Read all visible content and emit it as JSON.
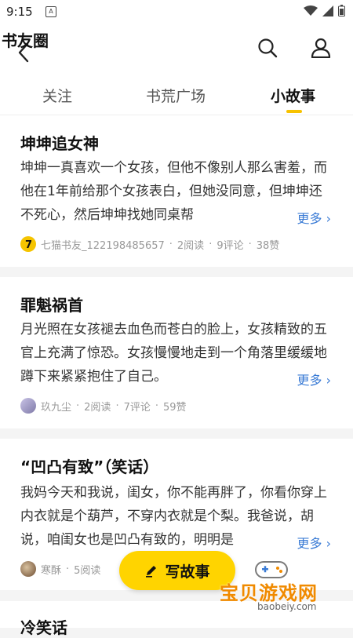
{
  "status_bar": {
    "time": "9:15",
    "notif_glyph": "A"
  },
  "app_bar": {
    "title": "书友圈"
  },
  "tabs": [
    {
      "label": "关注"
    },
    {
      "label": "书荒广场"
    },
    {
      "label": "小故事",
      "active": true
    }
  ],
  "stories": [
    {
      "title": "坤坤追女神",
      "body": "坤坤一真喜欢一个女孩，但他不像别人那么害羞，而他在1年前给那个女孩表白，但她没同意，但坤坤还不死心，然后坤坤找她同桌帮",
      "more": "更多 ›",
      "author": "七猫书友_122198485657",
      "reads": "2阅读",
      "comments": "9评论",
      "likes": "38赞"
    },
    {
      "title": "罪魁祸首",
      "body": "月光照在女孩褪去血色而苍白的脸上，女孩精致的五官上充满了惊恐。女孩慢慢地走到一个角落里缓缓地蹲下来紧紧抱住了自己。",
      "more": "更多 ›",
      "author": "玖九尘",
      "reads": "2阅读",
      "comments": "7评论",
      "likes": "59赞"
    },
    {
      "title": "“凹凸有致”（笑话）",
      "body": "我妈今天和我说，闺女，你不能再胖了，你看你穿上内衣就是个葫芦，不穿内衣就是个梨。我爸说，胡说，咱闺女也是凹凸有致的，明明是",
      "more": "更多 ›",
      "author": "寒酥",
      "reads": "5阅读",
      "comments": "",
      "likes": ""
    },
    {
      "title": "冷笑话"
    }
  ],
  "dot": "·",
  "fab": {
    "label": "写故事"
  },
  "watermark": {
    "text": "宝贝游戏网",
    "url": "baobeiy.com"
  },
  "colors": {
    "accent": "#ffd400",
    "link": "#3a7bd5",
    "tab_indicator": "#f7c200"
  }
}
